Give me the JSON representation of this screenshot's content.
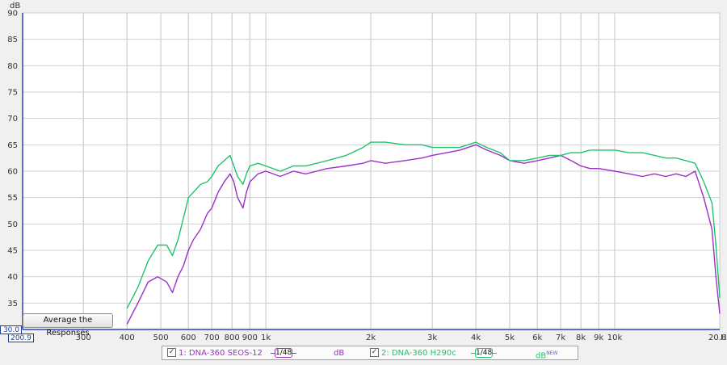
{
  "chart_data": {
    "type": "line",
    "ylabel": "dB",
    "xlabel": "Hz",
    "x_scale": "log",
    "xlim": [
      200.9,
      20000
    ],
    "ylim": [
      30,
      90
    ],
    "y_ticks": [
      35,
      40,
      45,
      50,
      55,
      60,
      65,
      70,
      75,
      80,
      85,
      90
    ],
    "x_tick_labels": [
      "300",
      "400",
      "500",
      "600",
      "700",
      "800",
      "900",
      "1k",
      "2k",
      "3k",
      "4k",
      "5k",
      "6k",
      "7k",
      "8k",
      "9k",
      "10k",
      "20.0k"
    ],
    "x_tick_values": [
      300,
      400,
      500,
      600,
      700,
      800,
      900,
      1000,
      2000,
      3000,
      4000,
      5000,
      6000,
      7000,
      8000,
      9000,
      10000,
      20000
    ],
    "grid": true,
    "series": [
      {
        "name": "1: DNA-360 SEOS-12",
        "color": "#9b30c8",
        "x": [
          400,
          430,
          460,
          490,
          520,
          540,
          560,
          580,
          600,
          620,
          650,
          680,
          700,
          730,
          760,
          790,
          810,
          830,
          860,
          880,
          900,
          950,
          1000,
          1100,
          1200,
          1300,
          1400,
          1500,
          1700,
          1900,
          2000,
          2200,
          2500,
          2800,
          3000,
          3300,
          3600,
          4000,
          4300,
          4700,
          5000,
          5500,
          6000,
          6500,
          7000,
          7500,
          8000,
          8500,
          9000,
          10000,
          11000,
          12000,
          13000,
          14000,
          15000,
          16000,
          17000,
          18000,
          19000,
          19500,
          20000
        ],
        "y": [
          31,
          35,
          39,
          40,
          39,
          37,
          40,
          42,
          45,
          47,
          49,
          52,
          53,
          56,
          58,
          59.5,
          58,
          55,
          53,
          56,
          58,
          59.5,
          60,
          59,
          60,
          59.5,
          60,
          60.5,
          61,
          61.5,
          62,
          61.5,
          62,
          62.5,
          63,
          63.5,
          64,
          65,
          64,
          63,
          62,
          61.5,
          62,
          62.5,
          63,
          62,
          61,
          60.5,
          60.5,
          60,
          59.5,
          59,
          59.5,
          59,
          59.5,
          59,
          60,
          55,
          49,
          40,
          33
        ]
      },
      {
        "name": "2: DNA-360 H290c",
        "color": "#1fc36e",
        "x": [
          400,
          430,
          460,
          490,
          520,
          540,
          560,
          580,
          600,
          620,
          650,
          680,
          700,
          730,
          760,
          790,
          810,
          830,
          860,
          880,
          900,
          950,
          1000,
          1100,
          1200,
          1300,
          1400,
          1500,
          1700,
          1900,
          2000,
          2200,
          2500,
          2800,
          3000,
          3300,
          3600,
          4000,
          4300,
          4700,
          5000,
          5500,
          6000,
          6500,
          7000,
          7500,
          8000,
          8500,
          9000,
          10000,
          11000,
          12000,
          13000,
          14000,
          15000,
          16000,
          17000,
          18000,
          19000,
          19500,
          20000
        ],
        "y": [
          34,
          38,
          43,
          46,
          46,
          44,
          47,
          51,
          55,
          56,
          57.5,
          58,
          59,
          61,
          62,
          63,
          61,
          59,
          57.5,
          59.5,
          61,
          61.5,
          61,
          60,
          61,
          61,
          61.5,
          62,
          63,
          64.5,
          65.5,
          65.5,
          65,
          65,
          64.5,
          64.5,
          64.5,
          65.5,
          64.5,
          63.5,
          62,
          62,
          62.5,
          63,
          63,
          63.5,
          63.5,
          64,
          64,
          64,
          63.5,
          63.5,
          63,
          62.5,
          62.5,
          62,
          61.5,
          58,
          54,
          46,
          36
        ]
      }
    ]
  },
  "ui": {
    "y_min_value": "30.0",
    "x_min_value": "200.9",
    "average_button": "Average the Responses",
    "legend": [
      {
        "check": "✓",
        "label": "1: DNA-360 SEOS-12",
        "smoothing": "1/48",
        "unit": "dB"
      },
      {
        "check": "✓",
        "label": "2: DNA-360 H290c",
        "smoothing": "1/48",
        "unit": "dB",
        "badge": "NEW"
      }
    ]
  }
}
